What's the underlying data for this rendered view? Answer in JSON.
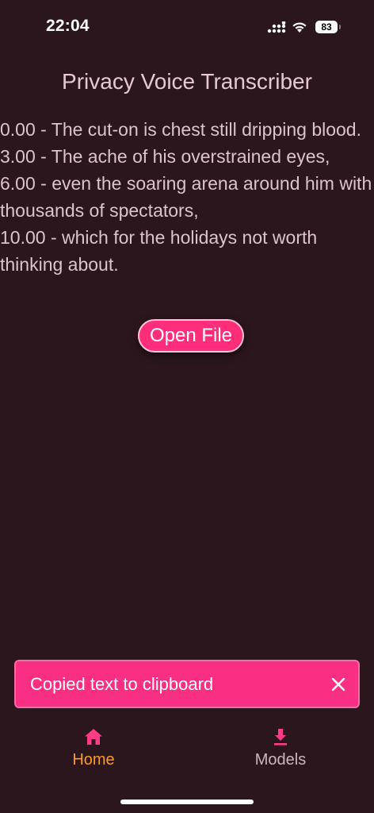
{
  "status_bar": {
    "time": "22:04",
    "battery": "83",
    "icons": [
      "signal-icon",
      "wifi-icon",
      "battery-icon"
    ]
  },
  "app": {
    "title": "Privacy Voice Transcriber"
  },
  "transcript": {
    "lines": [
      "0.00 - The cut-on is chest still dripping blood.",
      "3.00 - The ache of his overstrained eyes,",
      "6.00 - even the soaring arena around him with thousands of spectators,",
      "10.00 - which for the holidays not worth thinking about."
    ]
  },
  "open_file_button": {
    "label": "Open File"
  },
  "snackbar": {
    "message": "Copied text to clipboard",
    "close_icon": "close-icon"
  },
  "bottom_nav": {
    "items": [
      {
        "label": "Home",
        "icon": "home-icon",
        "active": true
      },
      {
        "label": "Models",
        "icon": "download-icon",
        "active": false
      }
    ]
  },
  "colors": {
    "background": "#2c161e",
    "accent": "#ff2d7a",
    "active_nav": "#ff9a1f",
    "text": "#ddc3cb"
  }
}
